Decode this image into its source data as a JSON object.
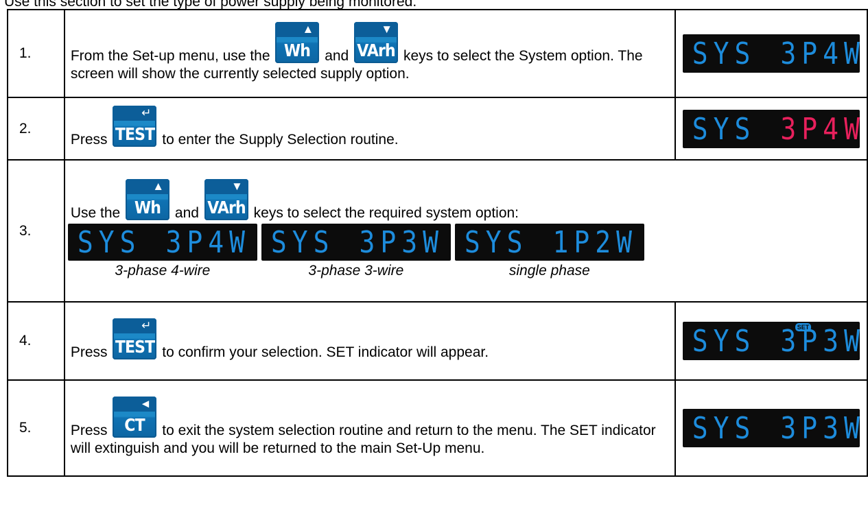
{
  "intro": "Use this section to set the type of power supply being monitored.",
  "keys": {
    "wh": {
      "label": "Wh",
      "arrow": "▲",
      "icon": "up-arrow-icon"
    },
    "varh": {
      "label": "VArh",
      "arrow": "▼",
      "icon": "down-arrow-icon"
    },
    "test": {
      "label": "TEST",
      "arrow": "↵",
      "icon": "enter-arrow-icon"
    },
    "ct": {
      "label": "CT",
      "arrow": "◄",
      "icon": "left-arrow-icon"
    }
  },
  "colors": {
    "key_blue": "#1c89c7",
    "lcd_blue": "#1d8cdc",
    "lcd_pink": "#e8205c",
    "lcd_bg": "#0c0c0c"
  },
  "steps": [
    {
      "num": "1.",
      "pre": "From the Set-up menu, use the",
      "mid": "and",
      "post": "keys to select the System option.  The screen will show the currently selected supply option.",
      "display": {
        "a": "SYS",
        "b": "3P4W"
      }
    },
    {
      "num": "2.",
      "pre": "Press",
      "post": "to enter the Supply Selection routine.",
      "display": {
        "a": "SYS",
        "b": "3P4W"
      }
    },
    {
      "num": "3.",
      "pre": "Use the",
      "mid": "and",
      "post": "keys to select the required system option:",
      "options": [
        {
          "a": "SYS",
          "b": "3P4W",
          "caption": "3-phase 4-wire"
        },
        {
          "a": "SYS",
          "b": "3P3W",
          "caption": "3-phase 3-wire"
        },
        {
          "a": "SYS",
          "b": "1P2W",
          "caption": "single phase"
        }
      ]
    },
    {
      "num": "4.",
      "pre": "Press",
      "post": "to confirm your selection.  SET indicator will appear.",
      "display": {
        "a": "SYS",
        "b": "3P3W",
        "badge": "SET"
      }
    },
    {
      "num": "5.",
      "pre": "Press",
      "post": "to exit the system selection routine and return to the menu.  The SET indicator will extinguish and you will be returned to the main Set-Up menu.",
      "display": {
        "a": "SYS",
        "b": "3P3W"
      }
    }
  ]
}
